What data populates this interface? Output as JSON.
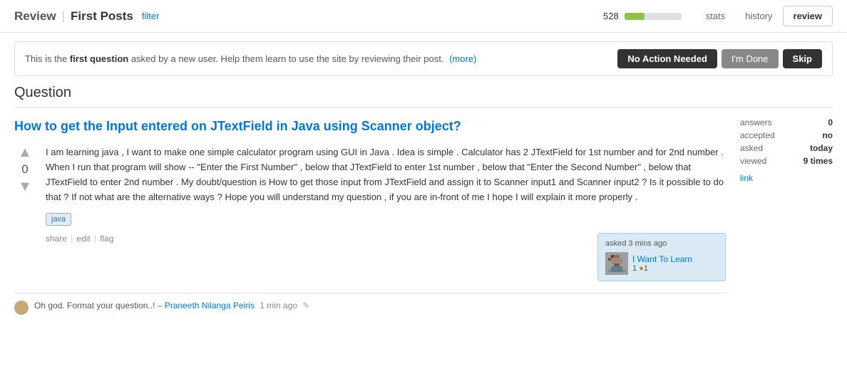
{
  "header": {
    "review_label": "Review",
    "separator": "|",
    "title": "First Posts",
    "filter_label": "filter",
    "progress_count": "528",
    "progress_percent": 35,
    "stats_tab": "stats",
    "history_tab": "history",
    "review_tab": "review"
  },
  "notice": {
    "text_start": "This is the ",
    "bold_text": "first question",
    "text_end": " asked by a new user. Help them learn to use the site by reviewing their post.",
    "more_link": "(more)",
    "btn_no_action": "No Action Needed",
    "btn_done": "I'm Done",
    "btn_skip": "Skip"
  },
  "section": {
    "label": "Question"
  },
  "question": {
    "title": "How to get the Input entered on JTextField in Java using Scanner object?",
    "body": "I am learning java , I want to make one simple calculator program using GUI in Java . Idea is simple . Calculator has 2 JTextField for 1st number and for 2nd number . When I run that program will show -- \"Enter the First Number\" , below that JTextField to enter 1st number , below that \"Enter the Second Number\" , below that JTextField to enter 2nd number . My doubt/question is How to get those input from JTextField and assign it to Scanner input1 and Scanner input2 ? Is it possible to do that ? If not what are the alternative ways ? Hope you will understand my question , if you are in-front of me I hope I will explain it more properly .",
    "vote_count": "0",
    "tags": [
      "java"
    ],
    "share_label": "share",
    "edit_label": "edit",
    "flag_label": "flag"
  },
  "sidebar": {
    "answers_label": "answers",
    "answers_value": "0",
    "accepted_label": "accepted",
    "accepted_value": "no",
    "asked_label": "asked",
    "asked_value": "today",
    "viewed_label": "viewed",
    "viewed_value": "9 times",
    "link_label": "link"
  },
  "user_card": {
    "time": "asked 3 mins ago",
    "name": "I Want To Learn",
    "rep": "1",
    "badge": "●1"
  },
  "comment": {
    "text": "Oh god. Format your question..! –",
    "author": "Praneeth Nilanga Peiris",
    "time": "1 min ago"
  }
}
